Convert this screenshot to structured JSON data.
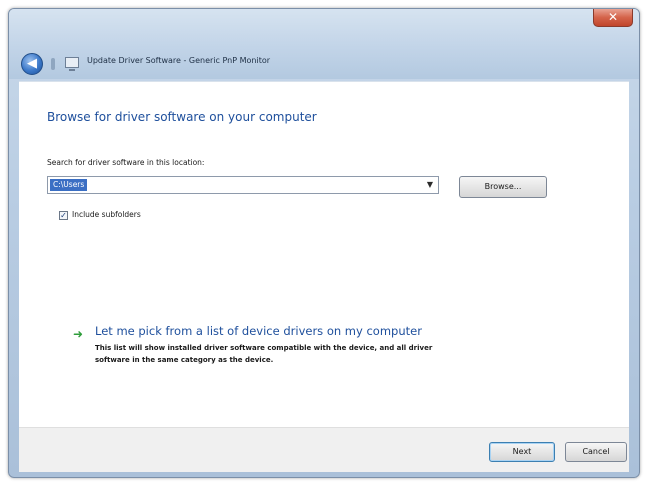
{
  "window": {
    "title": "Update Driver Software - Generic PnP Monitor",
    "close_glyph": "✕"
  },
  "nav": {
    "back_glyph": "◀"
  },
  "content": {
    "heading": "Browse for driver software on your computer",
    "search_label": "Search for driver software in this location:",
    "path_value": "C:\\Users",
    "dropdown_glyph": "▼",
    "browse_label": "Browse...",
    "include_subfolders_label": "Include subfolders",
    "include_subfolders_checked": true,
    "checkbox_glyph": "✓"
  },
  "pick_option": {
    "arrow_glyph": "➜",
    "title": "Let me pick from a list of device drivers on my computer",
    "description_line1": "This list will show installed driver software compatible with the device, and all driver",
    "description_line2": "software in the same category as the device."
  },
  "footer": {
    "next_label": "Next",
    "cancel_label": "Cancel"
  },
  "icons": {
    "back": "back-arrow-icon",
    "device": "monitor-icon",
    "option_arrow": "green-arrow-icon",
    "close": "close-icon"
  }
}
